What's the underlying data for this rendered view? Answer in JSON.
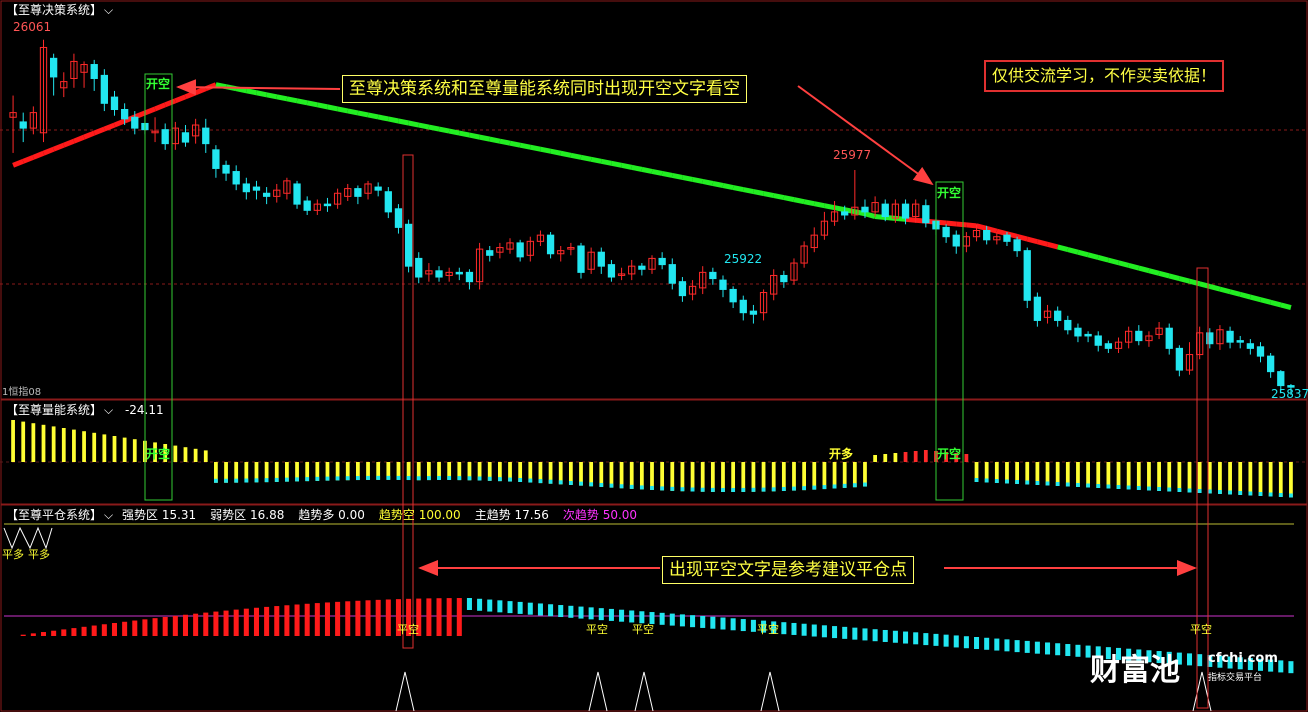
{
  "colors": {
    "up": "#ff2a2a",
    "down": "#22e6f0",
    "green_line": "#22ee22",
    "red_line": "#ff1a1a",
    "yellow": "#ffff33",
    "cyan": "#22e6f0",
    "magenta": "#ff33ff",
    "note_border": "#ffff66",
    "warn_border": "#e03030",
    "signal_box_green": "#33cc33",
    "signal_box_red": "#e03030"
  },
  "panels": {
    "top": {
      "title": "【至尊决策系统】",
      "sub_label": "1恒指08"
    },
    "middle": {
      "title": "【至尊量能系统】",
      "value": "-24.11"
    },
    "bottom": {
      "title": "【至尊平仓系统】",
      "indicators": [
        {
          "label": "强势区",
          "value": "15.31",
          "color": "#ffffff"
        },
        {
          "label": "弱势区",
          "value": "16.88",
          "color": "#ffffff"
        },
        {
          "label": "趋势多",
          "value": "0.00",
          "color": "#ffffff"
        },
        {
          "label": "趋势空",
          "value": "100.00",
          "color": "#ffff33"
        },
        {
          "label": "主趋势",
          "value": "17.56",
          "color": "#ffffff"
        },
        {
          "label": "次趋势",
          "value": "50.00",
          "color": "#ff33ff"
        }
      ]
    }
  },
  "annotations": {
    "top_note": "至尊决策系统和至尊量能系统同时出现开空文字看空",
    "disclaimer": "仅供交流学习，不作买卖依据！",
    "bottom_note": "出现平空文字是参考建议平仓点"
  },
  "signals": {
    "kai_kong": "开空",
    "kai_duo": "开多",
    "ping_kong": "平空",
    "ping_duo": "平多"
  },
  "watermark": {
    "brand": "财富池",
    "domain": "cfchi.com",
    "slogan": "指标交易平台"
  },
  "chart_data": {
    "type": "candlestick",
    "instrument": "恒指08",
    "price_labels": {
      "high1": "26061",
      "high2": "25977",
      "low1": "25922",
      "last": "25837"
    },
    "ylim": [
      25830,
      26075
    ],
    "candles": [
      [
        26011,
        26014,
        25988,
        26025
      ],
      [
        26008,
        26004,
        25995,
        26014
      ],
      [
        26004,
        26014,
        26000,
        26018
      ],
      [
        26001,
        26056,
        25995,
        26061
      ],
      [
        26049,
        26037,
        26025,
        26052
      ],
      [
        26030,
        26034,
        26024,
        26040
      ],
      [
        26036,
        26047,
        26030,
        26052
      ],
      [
        26040,
        26045,
        26030,
        26047
      ],
      [
        26045,
        26036,
        26028,
        26048
      ],
      [
        26038,
        26020,
        26015,
        26042
      ],
      [
        26024,
        26016,
        26012,
        26028
      ],
      [
        26016,
        26010,
        26006,
        26020
      ],
      [
        26011,
        26004,
        26000,
        26015
      ],
      [
        26007,
        26003,
        26000,
        26012
      ],
      [
        26001,
        26002,
        25995,
        26011
      ],
      [
        26003,
        25994,
        25990,
        26007
      ],
      [
        25994,
        26004,
        25990,
        26008
      ],
      [
        26001,
        25995,
        25992,
        26006
      ],
      [
        25999,
        26006,
        25994,
        26010
      ],
      [
        26004,
        25994,
        25988,
        26010
      ],
      [
        25990,
        25978,
        25972,
        25993
      ],
      [
        25980,
        25975,
        25970,
        25983
      ],
      [
        25976,
        25968,
        25964,
        25980
      ],
      [
        25968,
        25963,
        25958,
        25972
      ],
      [
        25966,
        25964,
        25958,
        25970
      ],
      [
        25962,
        25960,
        25955,
        25966
      ],
      [
        25960,
        25964,
        25956,
        25968
      ],
      [
        25962,
        25970,
        25958,
        25972
      ],
      [
        25968,
        25955,
        25952,
        25970
      ],
      [
        25957,
        25951,
        25948,
        25960
      ],
      [
        25951,
        25955,
        25948,
        25958
      ],
      [
        25955,
        25954,
        25950,
        25959
      ],
      [
        25955,
        25962,
        25952,
        25965
      ],
      [
        25960,
        25965,
        25957,
        25968
      ],
      [
        25965,
        25960,
        25955,
        25967
      ],
      [
        25962,
        25968,
        25958,
        25970
      ],
      [
        25966,
        25964,
        25960,
        25969
      ],
      [
        25963,
        25950,
        25946,
        25966
      ],
      [
        25952,
        25940,
        25936,
        25955
      ],
      [
        25942,
        25915,
        25911,
        25945
      ],
      [
        25920,
        25908,
        25904,
        25924
      ],
      [
        25910,
        25912,
        25905,
        25917
      ],
      [
        25912,
        25908,
        25905,
        25915
      ],
      [
        25909,
        25911,
        25905,
        25914
      ],
      [
        25911,
        25910,
        25906,
        25914
      ],
      [
        25911,
        25905,
        25900,
        25913
      ],
      [
        25905,
        25926,
        25900,
        25930
      ],
      [
        25925,
        25922,
        25918,
        25928
      ],
      [
        25924,
        25927,
        25920,
        25930
      ],
      [
        25926,
        25930,
        25923,
        25933
      ],
      [
        25930,
        25921,
        25918,
        25932
      ],
      [
        25922,
        25931,
        25918,
        25934
      ],
      [
        25931,
        25935,
        25928,
        25938
      ],
      [
        25935,
        25923,
        25920,
        25937
      ],
      [
        25923,
        25925,
        25918,
        25928
      ],
      [
        25926,
        25927,
        25922,
        25930
      ],
      [
        25928,
        25911,
        25907,
        25930
      ],
      [
        25913,
        25924,
        25910,
        25927
      ],
      [
        25924,
        25915,
        25910,
        25927
      ],
      [
        25916,
        25908,
        25905,
        25919
      ],
      [
        25910,
        25910,
        25906,
        25914
      ],
      [
        25910,
        25915,
        25906,
        25919
      ],
      [
        25915,
        25913,
        25909,
        25917
      ],
      [
        25913,
        25920,
        25910,
        25922
      ],
      [
        25920,
        25916,
        25913,
        25924
      ],
      [
        25916,
        25904,
        25900,
        25920
      ],
      [
        25905,
        25896,
        25892,
        25908
      ],
      [
        25897,
        25902,
        25893,
        25906
      ],
      [
        25901,
        25911,
        25897,
        25915
      ],
      [
        25911,
        25907,
        25903,
        25914
      ],
      [
        25906,
        25900,
        25895,
        25909
      ],
      [
        25900,
        25892,
        25888,
        25902
      ],
      [
        25893,
        25885,
        25880,
        25896
      ],
      [
        25886,
        25884,
        25878,
        25890
      ],
      [
        25885,
        25898,
        25880,
        25900
      ],
      [
        25897,
        25909,
        25893,
        25913
      ],
      [
        25909,
        25905,
        25901,
        25912
      ],
      [
        25906,
        25917,
        25903,
        25920
      ],
      [
        25917,
        25928,
        25914,
        25931
      ],
      [
        25927,
        25935,
        25924,
        25940
      ],
      [
        25935,
        25944,
        25932,
        25950
      ],
      [
        25944,
        25950,
        25941,
        25957
      ],
      [
        25950,
        25948,
        25945,
        25954
      ],
      [
        25948,
        25953,
        25945,
        25977
      ],
      [
        25953,
        25950,
        25946,
        25958
      ],
      [
        25950,
        25956,
        25947,
        25960
      ],
      [
        25955,
        25947,
        25944,
        25958
      ],
      [
        25946,
        25955,
        25943,
        25958
      ],
      [
        25955,
        25946,
        25942,
        25958
      ],
      [
        25947,
        25955,
        25943,
        25958
      ],
      [
        25954,
        25943,
        25940,
        25958
      ],
      [
        25944,
        25939,
        25935,
        25946
      ],
      [
        25940,
        25934,
        25930,
        25942
      ],
      [
        25935,
        25928,
        25923,
        25938
      ],
      [
        25928,
        25934,
        25924,
        25937
      ],
      [
        25934,
        25938,
        25931,
        25942
      ],
      [
        25938,
        25932,
        25929,
        25941
      ],
      [
        25932,
        25934,
        25929,
        25937
      ],
      [
        25935,
        25931,
        25928,
        25937
      ],
      [
        25932,
        25925,
        25921,
        25934
      ],
      [
        25925,
        25893,
        25888,
        25927
      ],
      [
        25895,
        25880,
        25876,
        25898
      ],
      [
        25882,
        25886,
        25878,
        25890
      ],
      [
        25886,
        25880,
        25876,
        25889
      ],
      [
        25880,
        25874,
        25871,
        25883
      ],
      [
        25875,
        25870,
        25866,
        25878
      ],
      [
        25871,
        25870,
        25866,
        25873
      ],
      [
        25870,
        25864,
        25860,
        25873
      ],
      [
        25865,
        25862,
        25859,
        25867
      ],
      [
        25862,
        25866,
        25859,
        25869
      ],
      [
        25866,
        25873,
        25862,
        25876
      ],
      [
        25873,
        25867,
        25864,
        25877
      ],
      [
        25867,
        25870,
        25863,
        25873
      ],
      [
        25871,
        25875,
        25868,
        25879
      ],
      [
        25875,
        25862,
        25858,
        25878
      ],
      [
        25862,
        25848,
        25844,
        25864
      ],
      [
        25848,
        25858,
        25845,
        25866
      ],
      [
        25858,
        25872,
        25855,
        25876
      ],
      [
        25872,
        25865,
        25862,
        25875
      ],
      [
        25865,
        25874,
        25861,
        25877
      ],
      [
        25873,
        25866,
        25862,
        25876
      ],
      [
        25867,
        25866,
        25862,
        25870
      ],
      [
        25865,
        25862,
        25858,
        25868
      ],
      [
        25863,
        25857,
        25853,
        25866
      ],
      [
        25857,
        25847,
        25843,
        25859
      ],
      [
        25847,
        25838,
        25834,
        25848
      ],
      [
        25838,
        25837,
        25832,
        25839
      ]
    ],
    "ma_green": [
      26016,
      26019,
      26021,
      26023,
      26024,
      26025,
      26025,
      26024,
      26022,
      26020,
      26017,
      26013,
      26010,
      26006,
      26003,
      25999,
      25995,
      25991,
      25987,
      25983
    ],
    "signal_boxes": [
      {
        "x_index": 18,
        "panel": "top-mid",
        "label": "开空"
      },
      {
        "x_index": 109,
        "panel": "top-mid",
        "label": "开空"
      },
      {
        "x_index": 43,
        "panel": "span",
        "label": "平空"
      },
      {
        "x_index": 146,
        "panel": "span",
        "label": "平空"
      }
    ]
  }
}
